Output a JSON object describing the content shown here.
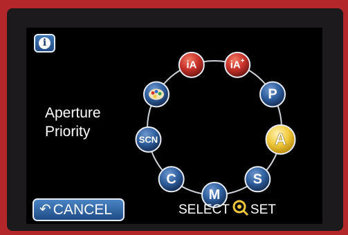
{
  "screen": {
    "info_button": {
      "label": "i",
      "icon": "info-icon"
    },
    "selected_mode": {
      "line1": "Aperture",
      "line2": "Priority"
    },
    "dial": {
      "modes": [
        {
          "id": "ia",
          "label": "iA",
          "style": "red",
          "selected": false
        },
        {
          "id": "ia_plus",
          "label": "iA",
          "sup": "+",
          "style": "red",
          "selected": false
        },
        {
          "id": "p",
          "label": "P",
          "style": "blue",
          "selected": false
        },
        {
          "id": "a",
          "label": "A",
          "style": "selected",
          "selected": true
        },
        {
          "id": "s",
          "label": "S",
          "style": "blue",
          "selected": false
        },
        {
          "id": "m",
          "label": "M",
          "style": "blue",
          "selected": false
        },
        {
          "id": "c",
          "label": "C",
          "style": "blue",
          "selected": false
        },
        {
          "id": "scn",
          "label": "SCN",
          "style": "blue",
          "selected": false
        },
        {
          "id": "creative",
          "label": "",
          "icon": "palette-icon",
          "style": "blue",
          "selected": false
        }
      ]
    },
    "cancel_button": {
      "label": "CANCEL",
      "icon": "return-arrow-icon"
    },
    "hint": {
      "select": "SELECT",
      "set": "SET",
      "icon": "control-dial-icon"
    },
    "colors": {
      "selected": "#f0c93c",
      "button_blue": "#2f5f9e",
      "mode_red": "#c8322a",
      "case_red": "#b3262a"
    }
  }
}
